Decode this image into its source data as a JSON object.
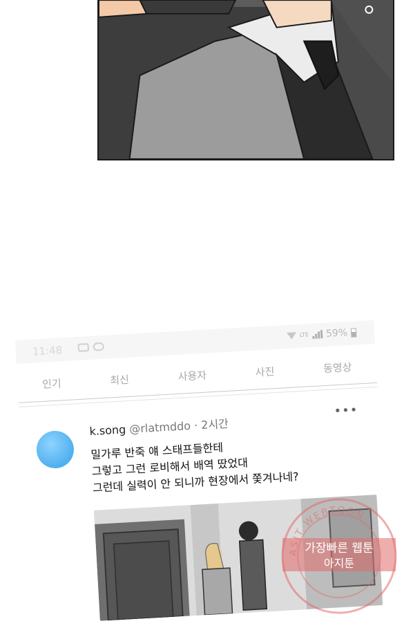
{
  "status_bar": {
    "time": "11:48",
    "network": "LTE",
    "battery": "59%"
  },
  "tabs": [
    "인기",
    "최신",
    "사용자",
    "사진",
    "동영상"
  ],
  "tweet": {
    "display_name": "k.song",
    "handle": "@rlatmddo",
    "separator": "·",
    "time": "2시간",
    "more": "•••",
    "lines": [
      "밀가루 반죽 얘 스태프들한테",
      "그렇고 그런 로비해서 배역 땄었대",
      "그런데 실력이 안 되니까 현장에서 쫓겨나네?"
    ]
  },
  "watermark": {
    "arc_text": "ASIT WEBTOON",
    "line1": "가장빠른 웹툰",
    "line2": "아지툰"
  },
  "colors": {
    "avatar": "#4fb0ef",
    "watermark": "#e26b6b"
  }
}
